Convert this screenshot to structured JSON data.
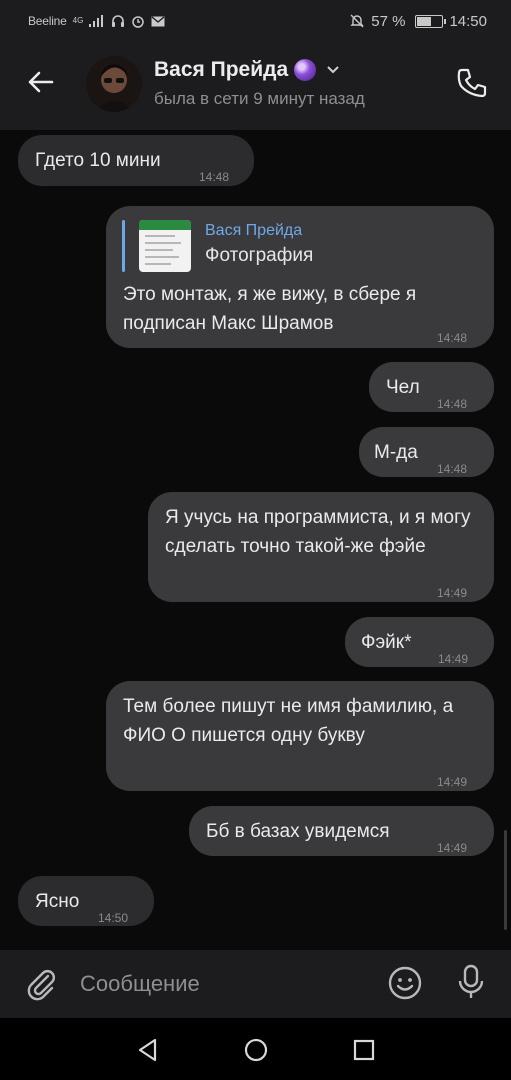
{
  "status_bar": {
    "carrier": "Beeline",
    "network": "4G",
    "battery_percent": "57 %",
    "battery_level": 0.57,
    "time": "14:50"
  },
  "header": {
    "back_icon": "arrow-left",
    "contact_name": "Вася Прейда",
    "contact_status": "была в сети 9 минут назад",
    "call_icon": "phone"
  },
  "messages": [
    {
      "side": "in",
      "text": "Гдето 10 мини",
      "time": "14:48"
    },
    {
      "side": "out",
      "reply": {
        "from": "Вася Прейда",
        "type": "Фотография"
      },
      "text": "Это монтаж, я же вижу, в сбере я подписан Макс Шрамов",
      "time": "14:48"
    },
    {
      "side": "out",
      "text": "Чел",
      "time": "14:48"
    },
    {
      "side": "out",
      "text": "М-да",
      "time": "14:48"
    },
    {
      "side": "out",
      "text": "Я учусь на программиста, и я могу сделать точно такой-же фэйе",
      "time": "14:49"
    },
    {
      "side": "out",
      "text": "Фэйк*",
      "time": "14:49"
    },
    {
      "side": "out",
      "text": "Тем более пишут не имя фамилию, а ФИО О пишется одну букву",
      "time": "14:49"
    },
    {
      "side": "out",
      "text": "Бб в базах увидемся",
      "time": "14:49"
    },
    {
      "side": "in",
      "text": "Ясно",
      "time": "14:50"
    }
  ],
  "input": {
    "placeholder": "Сообщение"
  },
  "colors": {
    "background": "#0a0a0a",
    "bar": "#1c1c1e",
    "incoming": "#2c2c2e",
    "outgoing": "#3a3a3c",
    "accent": "#6fa8e8"
  }
}
